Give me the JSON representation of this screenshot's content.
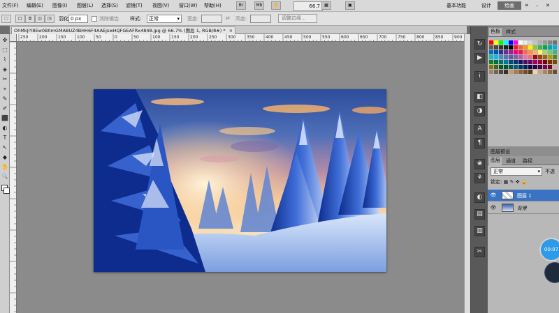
{
  "menubar": {
    "items": [
      "文件(F)",
      "编辑(E)",
      "图像(I)",
      "图层(L)",
      "选择(S)",
      "滤镜(T)",
      "视图(V)",
      "窗口(W)",
      "帮助(H)"
    ],
    "zoom_value": "66.7",
    "workspaces": [
      "基本功能",
      "设计",
      "绘画"
    ],
    "active_workspace_index": 2
  },
  "options": {
    "feather_label": "羽化:",
    "feather_value": "0 px",
    "antialias_label": "消除锯齿",
    "style_label": "样式:",
    "style_value": "正常",
    "width_label": "宽度:",
    "height_label": "高度:",
    "refine_edge_label": "调整边缘..."
  },
  "document": {
    "tab_title": "OhMkJlY8Ew0B0mGMABUZ4BHH6F4AAEjswHQFGEAFRx4848.jpg @ 66.7% (图层 1, RGB/8#) *",
    "tab_close": "×"
  },
  "rulers": {
    "h_ticks": [
      "250",
      "200",
      "150",
      "100",
      "50",
      "0",
      "50",
      "100",
      "150",
      "200",
      "250",
      "300",
      "350",
      "400",
      "450",
      "500",
      "550",
      "600",
      "650",
      "700",
      "750",
      "800",
      "850",
      "900"
    ]
  },
  "tools": [
    "⬚",
    "✜",
    "⌇",
    "✎",
    "⌖",
    "✂",
    "◈",
    "✐",
    "⬛",
    "◐",
    "T",
    "↖",
    "◆",
    "✋",
    "🔍"
  ],
  "panels": {
    "swatches": {
      "tabs": [
        "色板",
        "样式"
      ],
      "active_tab_index": 0
    },
    "layers": {
      "tabs": [
        "图层",
        "通道",
        "路径"
      ],
      "title_tab": "图层预设",
      "blend_mode": "正常",
      "opacity_label": "不透",
      "lock_label": "锁定:",
      "layers": [
        {
          "name": "图层 1",
          "selected": true,
          "visible_icon": "eye-icon"
        },
        {
          "name": "背景",
          "selected": false,
          "visible_icon": "eye-icon"
        }
      ]
    }
  },
  "dock_icons": [
    "history-icon",
    "actions-icon",
    "info-icon",
    "navigator-icon",
    "character-icon",
    "paragraph-icon",
    "brush-icon",
    "clone-icon",
    "layers-icon",
    "channels-icon",
    "paths-icon",
    "notes-icon",
    "tools-icon"
  ],
  "overlay": {
    "timer_text": "00:07"
  },
  "colors": {
    "active_workspace": "#6d6d6d",
    "selected_layer": "#3b73c4",
    "timer_badge": "#2f9be8"
  }
}
